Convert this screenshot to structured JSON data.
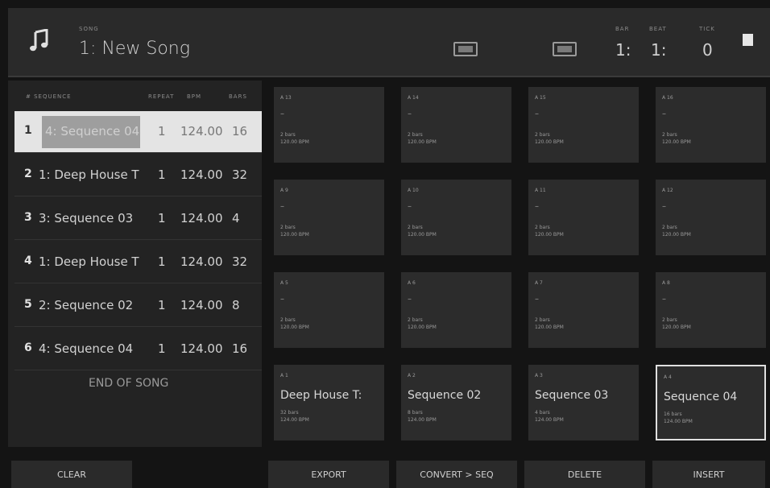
{
  "header": {
    "song_small_label": "SONG",
    "song_title": "1: New Song",
    "bar_label": "BAR",
    "beat_label": "BEAT",
    "tick_label": "TICK",
    "bar_value": "1:",
    "beat_value": "1:",
    "tick_value": "0",
    "icons": [
      "music-note-icon",
      "keyboard-icon",
      "display-icon",
      "stop-icon"
    ]
  },
  "list": {
    "columns": {
      "sequence": "# SEQUENCE",
      "repeat": "REPEAT",
      "bpm": "BPM",
      "bars": "BARS"
    },
    "rows": [
      {
        "num": "1",
        "name": "4: Sequence 04",
        "repeat": "1",
        "bpm": "124.00",
        "bars": "16",
        "selected": true
      },
      {
        "num": "2",
        "name": "1: Deep House T",
        "repeat": "1",
        "bpm": "124.00",
        "bars": "32"
      },
      {
        "num": "3",
        "name": "3: Sequence 03",
        "repeat": "1",
        "bpm": "124.00",
        "bars": "4"
      },
      {
        "num": "4",
        "name": "1: Deep House T",
        "repeat": "1",
        "bpm": "124.00",
        "bars": "32"
      },
      {
        "num": "5",
        "name": "2: Sequence 02",
        "repeat": "1",
        "bpm": "124.00",
        "bars": "8"
      },
      {
        "num": "6",
        "name": "4: Sequence 04",
        "repeat": "1",
        "bpm": "124.00",
        "bars": "16"
      }
    ],
    "end_label": "END OF SONG"
  },
  "grid": {
    "tiles": [
      {
        "label": "A 13",
        "dash": "–",
        "s1": "2 bars",
        "s2": "120.00 BPM"
      },
      {
        "label": "A 14",
        "dash": "–",
        "s1": "2 bars",
        "s2": "120.00 BPM"
      },
      {
        "label": "A 15",
        "dash": "–",
        "s1": "2 bars",
        "s2": "120.00 BPM"
      },
      {
        "label": "A 16",
        "dash": "–",
        "s1": "2 bars",
        "s2": "120.00 BPM"
      },
      {
        "label": "A 9",
        "dash": "–",
        "s1": "2 bars",
        "s2": "120.00 BPM"
      },
      {
        "label": "A 10",
        "dash": "–",
        "s1": "2 bars",
        "s2": "120.00 BPM"
      },
      {
        "label": "A 11",
        "dash": "–",
        "s1": "2 bars",
        "s2": "120.00 BPM"
      },
      {
        "label": "A 12",
        "dash": "–",
        "s1": "2 bars",
        "s2": "120.00 BPM"
      },
      {
        "label": "A 5",
        "dash": "–",
        "s1": "2 bars",
        "s2": "120.00 BPM"
      },
      {
        "label": "A 6",
        "dash": "–",
        "s1": "2 bars",
        "s2": "120.00 BPM"
      },
      {
        "label": "A 7",
        "dash": "–",
        "s1": "2 bars",
        "s2": "120.00 BPM"
      },
      {
        "label": "A 8",
        "dash": "–",
        "s1": "2 bars",
        "s2": "120.00 BPM"
      },
      {
        "label": "A 1",
        "name": "Deep House T:",
        "s1": "32 bars",
        "s2": "124.00 BPM"
      },
      {
        "label": "A 2",
        "name": "Sequence 02",
        "s1": "8 bars",
        "s2": "124.00 BPM"
      },
      {
        "label": "A 3",
        "name": "Sequence 03",
        "s1": "4 bars",
        "s2": "124.00 BPM"
      },
      {
        "label": "A 4",
        "name": "Sequence 04",
        "s1": "16 bars",
        "s2": "124.00 BPM",
        "active": true
      }
    ]
  },
  "buttons": {
    "clear": "CLEAR",
    "export": "EXPORT",
    "convert": "CONVERT > SEQ",
    "delete": "DELETE",
    "insert": "INSERT"
  }
}
